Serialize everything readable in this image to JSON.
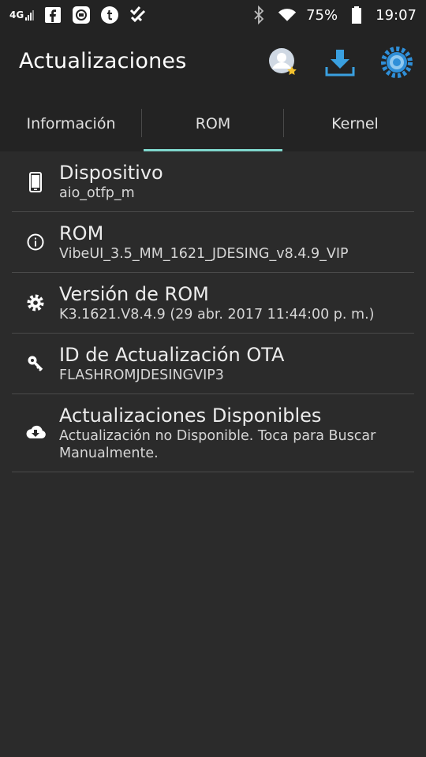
{
  "status_bar": {
    "network": "4G",
    "battery": "75%",
    "time": "19:07",
    "left_icons": [
      "facebook-icon",
      "qr-app-icon",
      "tumblr-icon",
      "tasks-check-icon"
    ],
    "right_icons": [
      "bluetooth-icon",
      "wifi-icon",
      "battery-icon"
    ]
  },
  "app_bar": {
    "title": "Actualizaciones",
    "actions": [
      "profile-star-icon",
      "download-icon",
      "settings-gear-icon"
    ]
  },
  "tabs": [
    {
      "label": "Información",
      "active": false
    },
    {
      "label": "ROM",
      "active": true
    },
    {
      "label": "Kernel",
      "active": false
    }
  ],
  "rows": [
    {
      "icon": "phone-icon",
      "title": "Dispositivo",
      "subtitle": "aio_otfp_m"
    },
    {
      "icon": "info-icon",
      "title": "ROM",
      "subtitle": "VibeUI_3.5_MM_1621_JDESING_v8.4.9_VIP"
    },
    {
      "icon": "gear-icon",
      "title": "Versión de ROM",
      "subtitle": "K3.1621.V8.4.9 (29 abr. 2017 11:44:00 p. m.)"
    },
    {
      "icon": "key-icon",
      "title": "ID de Actualización OTA",
      "subtitle": "FLASHROMJDESINGVIP3"
    },
    {
      "icon": "cloud-download-icon",
      "title": "Actualizaciones Disponibles",
      "subtitle": "Actualización no Disponible. Toca para Buscar Manualmente."
    }
  ],
  "colors": {
    "background": "#2b2b2b",
    "bar": "#232323",
    "accent_tab_indicator": "#7fd6cc",
    "download_blue": "#3aa0e0",
    "gear_blue": "#2f8fd8"
  }
}
